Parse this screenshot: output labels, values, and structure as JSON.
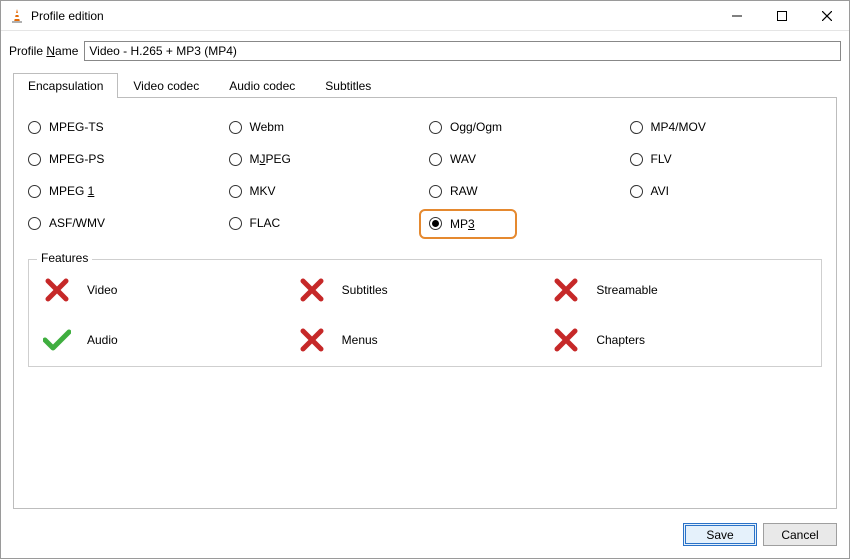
{
  "window": {
    "title": "Profile edition"
  },
  "profile": {
    "label_pre": "Profile ",
    "label_ul": "N",
    "label_post": "ame",
    "value": "Video - H.265 + MP3 (MP4)"
  },
  "tabs": [
    {
      "label": "Encapsulation",
      "active": true
    },
    {
      "label": "Video codec",
      "active": false
    },
    {
      "label": "Audio codec",
      "active": false
    },
    {
      "label": "Subtitles",
      "active": false
    }
  ],
  "radios": [
    {
      "label": "MPEG-TS",
      "selected": false
    },
    {
      "label": "Webm",
      "selected": false
    },
    {
      "label": "Ogg/Ogm",
      "selected": false
    },
    {
      "label": "MP4/MOV",
      "selected": false
    },
    {
      "label": "MPEG-PS",
      "selected": false
    },
    {
      "label_parts": [
        "M",
        "J",
        "PEG"
      ],
      "selected": false
    },
    {
      "label": "WAV",
      "selected": false
    },
    {
      "label": "FLV",
      "selected": false
    },
    {
      "label_parts": [
        "MPEG ",
        "1",
        ""
      ],
      "selected": false
    },
    {
      "label": "MKV",
      "selected": false
    },
    {
      "label": "RAW",
      "selected": false
    },
    {
      "label": "AVI",
      "selected": false
    },
    {
      "label": "ASF/WMV",
      "selected": false
    },
    {
      "label": "FLAC",
      "selected": false
    },
    {
      "label_parts": [
        "MP",
        "3",
        ""
      ],
      "selected": true,
      "highlight": true
    },
    null
  ],
  "features": {
    "legend": "Features",
    "items": [
      {
        "label": "Video",
        "state": "no"
      },
      {
        "label": "Subtitles",
        "state": "no"
      },
      {
        "label": "Streamable",
        "state": "no"
      },
      {
        "label": "Audio",
        "state": "yes"
      },
      {
        "label": "Menus",
        "state": "no"
      },
      {
        "label": "Chapters",
        "state": "no"
      }
    ]
  },
  "buttons": {
    "save": "Save",
    "cancel": "Cancel"
  }
}
